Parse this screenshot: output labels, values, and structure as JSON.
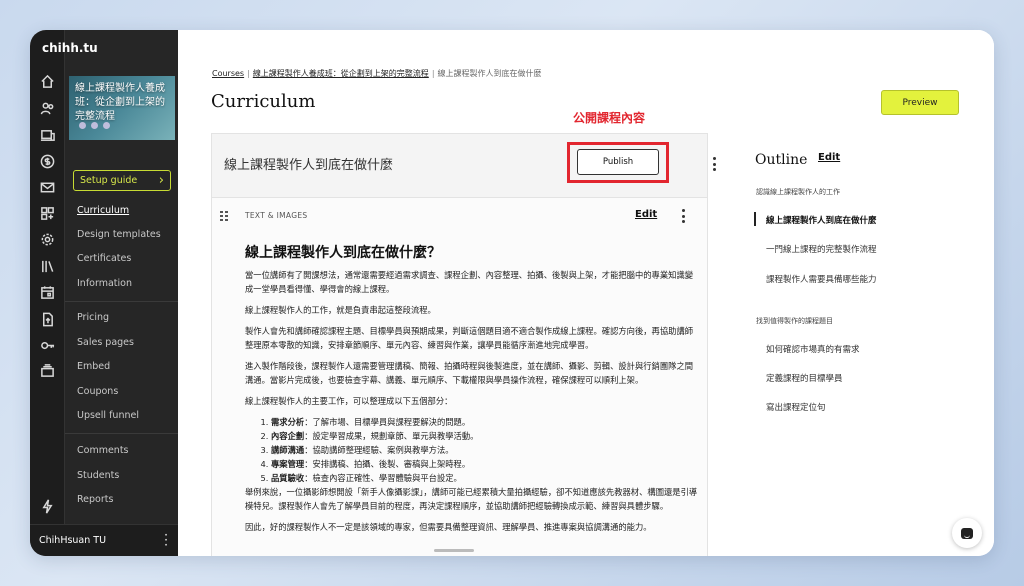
{
  "app": {
    "brand": "chihh.tu"
  },
  "sidebar": {
    "course_thumb_title": "線上課程製作人養成班：從企劃到上架的完整流程",
    "setup_guide": "Setup guide",
    "setup_arrow": "›",
    "items": [
      {
        "label": "Curriculum"
      },
      {
        "label": "Design templates"
      },
      {
        "label": "Certificates"
      },
      {
        "label": "Information"
      },
      {
        "label": "Pricing"
      },
      {
        "label": "Sales pages"
      },
      {
        "label": "Embed"
      },
      {
        "label": "Coupons"
      },
      {
        "label": "Upsell funnel"
      },
      {
        "label": "Comments"
      },
      {
        "label": "Students"
      },
      {
        "label": "Reports"
      }
    ],
    "user_name": "ChihHsuan TU",
    "rail_icons": [
      "home-icon",
      "users-icon",
      "devices-icon",
      "dollar-icon",
      "mail-icon",
      "apps-icon",
      "settings-icon",
      "library-icon",
      "calendar-icon",
      "upload-icon",
      "key-icon",
      "stack-icon",
      "bolt-icon"
    ]
  },
  "breadcrumb": {
    "root": "Courses",
    "course": "線上課程製作人養成班：從企劃到上架的完整流程",
    "current": "線上課程製作人到底在做什麼",
    "separator": "|"
  },
  "page_title": "Curriculum",
  "preview_label": "Preview",
  "annotation": "公開課程內容",
  "lesson": {
    "title": "線上課程製作人到底在做什麼",
    "publish_label": "Publish"
  },
  "block": {
    "label": "TEXT & IMAGES",
    "edit_label": "Edit",
    "heading": "線上課程製作人到底在做什麼？",
    "p1": "當一位講師有了開課想法，通常還需要經過需求調查、課程企劃、內容整理、拍攝、後製與上架，才能把腦中的專業知識變成一堂學員看得懂、學得會的線上課程。",
    "p2": "線上課程製作人的工作，就是負責串起這整段流程。",
    "p3": "製作人會先和講師確認課程主題、目標學員與預期成果，判斷這個題目適不適合製作成線上課程。確認方向後，再協助講師整理原本零散的知識，安排章節順序、單元內容、練習與作業，讓學員能循序漸進地完成學習。",
    "p4": "進入製作階段後，課程製作人還需要管理講稿、簡報、拍攝時程與後製進度，並在講師、攝影、剪輯、設計與行銷團隊之間溝通。當影片完成後，也要檢查字幕、講義、單元順序、下載權限與學員操作流程，確保課程可以順利上架。",
    "p5": "線上課程製作人的主要工作，可以整理成以下五個部分：",
    "list": [
      {
        "term": "需求分析",
        "desc": "：了解市場、目標學員與課程要解決的問題。"
      },
      {
        "term": "內容企劃",
        "desc": "：設定學習成果，規劃章節、單元與教學活動。"
      },
      {
        "term": "講師溝通",
        "desc": "：協助講師整理經驗、案例與教學方法。"
      },
      {
        "term": "專案管理",
        "desc": "：安排講稿、拍攝、後製、審稿與上架時程。"
      },
      {
        "term": "品質驗收",
        "desc": "：檢查內容正確性、學習體驗與平台設定。"
      }
    ],
    "p6": "舉例來說，一位攝影師想開設「新手人像攝影課」，講師可能已經累積大量拍攝經驗，卻不知道應該先教器材、構圖還是引導模特兒。課程製作人會先了解學員目前的程度，再決定課程順序，並協助講師把經驗轉換成示範、練習與具體步驟。",
    "p7": "因此，好的課程製作人不一定是該領域的專家，但需要具備整理資訊、理解學員、推進專案與協調溝通的能力。"
  },
  "outline": {
    "title": "Outline",
    "edit_label": "Edit",
    "groups": [
      {
        "name": "認識線上課程製作人的工作",
        "items": [
          "線上課程製作人到底在做什麼",
          "一門線上課程的完整製作流程",
          "課程製作人需要具備哪些能力"
        ]
      },
      {
        "name": "找到值得製作的課程題目",
        "items": [
          "如何確認市場真的有需求",
          "定義課程的目標學員",
          "寫出課程定位句"
        ]
      }
    ]
  },
  "colors": {
    "accent_lime": "#e3f23d",
    "annotation_red": "#e2262f",
    "sidebar_bg": "#262626"
  }
}
